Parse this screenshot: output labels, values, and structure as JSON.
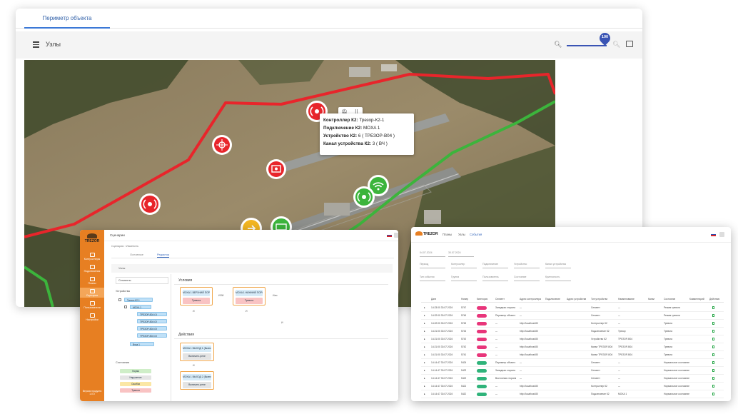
{
  "main": {
    "tab": "Периметр объекта",
    "toolbar_title": "Узлы",
    "zoom_value": "100",
    "tooltip": {
      "lines": [
        {
          "key": "Контроллер К2:",
          "value": "Трезор-К2-1"
        },
        {
          "key": "Подключение К2:",
          "value": "MOXA 1"
        },
        {
          "key": "Устройство К2:",
          "value": "6 ( ТРЕЗОР-В04 )"
        },
        {
          "key": "Канал устройства К2:",
          "value": "3 ( ВЧ )"
        }
      ]
    },
    "colors": {
      "perimeter_alarm": "#e8252b",
      "perimeter_ok": "#3cb43c",
      "accent": "#3a54b4"
    }
  },
  "win2": {
    "logo": "TREZOR",
    "top_title": "Сценарии",
    "breadcrumb": "Сценарии › Изменить",
    "tabs": [
      "Основные",
      "Редактор"
    ],
    "bar_title": "Узлы",
    "nav": [
      "Контроллеры",
      "Подключения",
      "Планы",
      "Сценарии",
      "Пользователи",
      "Настройки"
    ],
    "footer": "Версия продукта 1.0.0",
    "left": {
      "select_label": "Сегменты",
      "devices_label": "Устройства",
      "tree": [
        "Трезор-К2-1",
        "MOXA 1",
        "ТРЕЗОР-В04 (1)",
        "ТРЕЗОР-В04 (2)",
        "ТРЕЗОР-В04 (3)",
        "ТРЕЗОР-В04 (4)",
        "Вход 1",
        "Выход 1"
      ],
      "states_label": "Состояния",
      "states": [
        "Норма",
        "Нарушение",
        "Ошибка",
        "Тревога"
      ]
    },
    "right": {
      "conditions_label": "Условия",
      "cond_a_top": "MOXA 1 ВЕРХНИЙ ПОРОГ",
      "cond_a_state": "Тревога",
      "cond_b_top": "MOXA 1 НИЖНИЙ ПОРОГ",
      "cond_b_state": "Тревога",
      "op_or": "ИЛИ",
      "op_and": "И",
      "op_add": "Или",
      "actions_label": "Действия",
      "act_a_top": "MOXA 1 ВЫХОД 1 (Включить)",
      "act_a_btn": "Включить реле",
      "act_b_top": "MOXA 1 ВЫХОД 2 (Включить)",
      "act_b_btn": "Включить реле"
    }
  },
  "win3": {
    "logo": "TREZOR",
    "links": [
      "Планы",
      "Узлы",
      "События"
    ],
    "filter_dates": [
      "04.07.2024",
      "30.07.2024"
    ],
    "filters": [
      "Период",
      "Контроллер",
      "Подключение",
      "Устройство",
      "Канал устройства",
      "Тип события",
      "Группа",
      "Пользователь",
      "Состояние",
      "Критичность"
    ],
    "columns": [
      "Дата",
      "Номер",
      "Категория",
      "Сегмент",
      "Адрес контроллера",
      "Подключение",
      "Адрес устройства",
      "Тип устройства",
      "Наименование",
      "Канал",
      "Состояние",
      "Комментарий",
      "Действия"
    ],
    "rows": [
      {
        "date": "14:23:00 30.07.2024",
        "num": "5747",
        "cat": "alarm",
        "seg": "Западная сторона",
        "addr": "—",
        "type": "Сегмент",
        "name": "—",
        "state": "Режим тревоги"
      },
      {
        "date": "14:22:00 30.07.2024",
        "num": "5746",
        "cat": "alarm",
        "seg": "Периметр объекта",
        "addr": "—",
        "type": "Сегмент",
        "name": "—",
        "state": "Режим тревоги"
      },
      {
        "date": "14:22:00 30.07.2024",
        "num": "5745",
        "cat": "alarm",
        "seg": "—",
        "addr": "http://localhost:80",
        "type": "Контроллер К2",
        "name": "—",
        "state": "Тревога"
      },
      {
        "date": "14:21:00 30.07.2024",
        "num": "5744",
        "cat": "alarm",
        "seg": "—",
        "addr": "http://localhost:80",
        "type": "Подключение К2",
        "name": "Трезор",
        "state": "Тревога"
      },
      {
        "date": "14:21:00 30.07.2024",
        "num": "5743",
        "cat": "alarm",
        "seg": "—",
        "addr": "http://localhost:80",
        "type": "Устройство К2",
        "name": "ТРЕЗОР-В04",
        "state": "Тревога"
      },
      {
        "date": "14:21:00 30.07.2024",
        "num": "5742",
        "cat": "alarm",
        "seg": "—",
        "addr": "http://localhost:80",
        "type": "Канал ТРЕЗОР-В04",
        "name": "ТРЕЗОР-В04",
        "state": "Тревога"
      },
      {
        "date": "14:21:00 30.07.2024",
        "num": "5741",
        "cat": "alarm",
        "seg": "—",
        "addr": "http://localhost:80",
        "type": "Канал ТРЕЗОР-В04",
        "name": "ТРЕЗОР-В04",
        "state": "Тревога"
      },
      {
        "date": "14:14:47 30.07.2024",
        "num": "5424",
        "cat": "norm",
        "seg": "Периметр объекта",
        "addr": "—",
        "type": "Сегмент",
        "name": "—",
        "state": "Нормальное состояние"
      },
      {
        "date": "14:14:47 30.07.2024",
        "num": "5423",
        "cat": "norm",
        "seg": "Западная сторона",
        "addr": "—",
        "type": "Сегмент",
        "name": "—",
        "state": "Нормальное состояние"
      },
      {
        "date": "14:14:47 30.07.2024",
        "num": "5422",
        "cat": "norm",
        "seg": "Восточная сторона",
        "addr": "—",
        "type": "Сегмент",
        "name": "—",
        "state": "Нормальное состояние"
      },
      {
        "date": "14:14:47 30.07.2024",
        "num": "5421",
        "cat": "norm",
        "seg": "—",
        "addr": "http://localhost:80",
        "type": "Контроллер К2",
        "name": "—",
        "state": "Нормальное состояние"
      },
      {
        "date": "14:14:47 30.07.2024",
        "num": "5420",
        "cat": "norm",
        "seg": "—",
        "addr": "http://localhost:80",
        "type": "Подключение К2",
        "name": "MOXA 1",
        "state": "Нормальное состояние"
      }
    ],
    "pill_colors": {
      "alarm": "#e8357a",
      "norm": "#2fb37a"
    }
  }
}
